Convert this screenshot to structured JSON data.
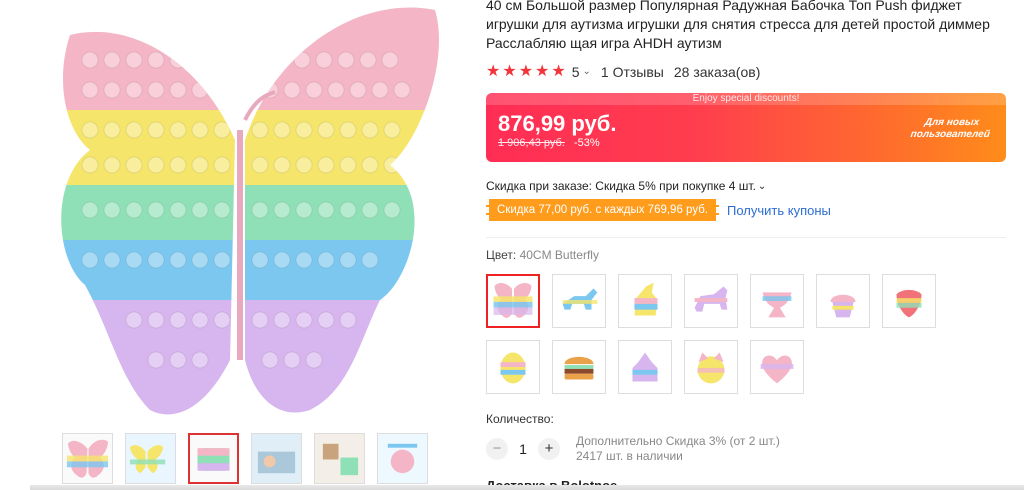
{
  "product": {
    "title": "40 см Большой размер Популярная Радужная Бабочка Топ Push фиджет игрушки для аутизма игрушки для снятия стресса для детей простой диммер Расслабляю щая игра AHDH аутизм",
    "rating": {
      "stars": 5,
      "value": "5",
      "reviews": "1 Отзывы",
      "orders": "28 заказа(ов)"
    },
    "price": {
      "banner": "Enjoy special discounts!",
      "current": "876,99 руб.",
      "old": "1 906,43 руб.",
      "discount": "-53%",
      "new_users": "Для новых пользователей"
    },
    "order_discount": "Скидка при заказе: Скидка 5% при покупке 4 шт.",
    "coupon": {
      "tag": "Скидка 77,00 руб. с каждых 769,96 руб.",
      "link": "Получить купоны"
    },
    "color": {
      "label": "Цвет:",
      "value": "40CM Butterfly"
    },
    "quantity": {
      "label": "Количество:",
      "minus": "−",
      "value": "1",
      "plus": "+",
      "extra_discount": "Дополнительно Скидка 3% (от 2 шт.)",
      "stock": "2417 шт. в наличии"
    },
    "delivery": "Доставка в Bolotnoe"
  },
  "icons": {
    "star": "star-icon",
    "chevron": "chevron-down-icon"
  },
  "colors": {
    "accent": "#ff2d55",
    "accent_end": "#ff8c1a",
    "coupon": "#ff9c1c",
    "link": "#2b6dd2",
    "star": "#f2343b"
  }
}
